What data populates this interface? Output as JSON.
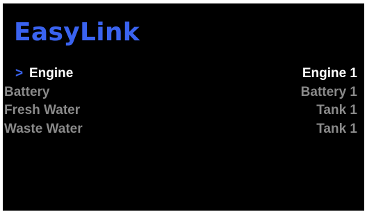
{
  "app": {
    "title": "EasyLink"
  },
  "colors": {
    "title": "#3a63f0",
    "cursor": "#3a63f0",
    "selected_text": "#ffffff",
    "unselected_text": "#8a8a8a",
    "background": "#000000"
  },
  "menu": {
    "cursor_glyph": ">",
    "selected_index": 0,
    "items": [
      {
        "label": "Engine",
        "value": "Engine 1"
      },
      {
        "label": "Battery",
        "value": "Battery 1"
      },
      {
        "label": "Fresh Water",
        "value": "Tank 1"
      },
      {
        "label": "Waste Water",
        "value": "Tank 1"
      }
    ]
  }
}
